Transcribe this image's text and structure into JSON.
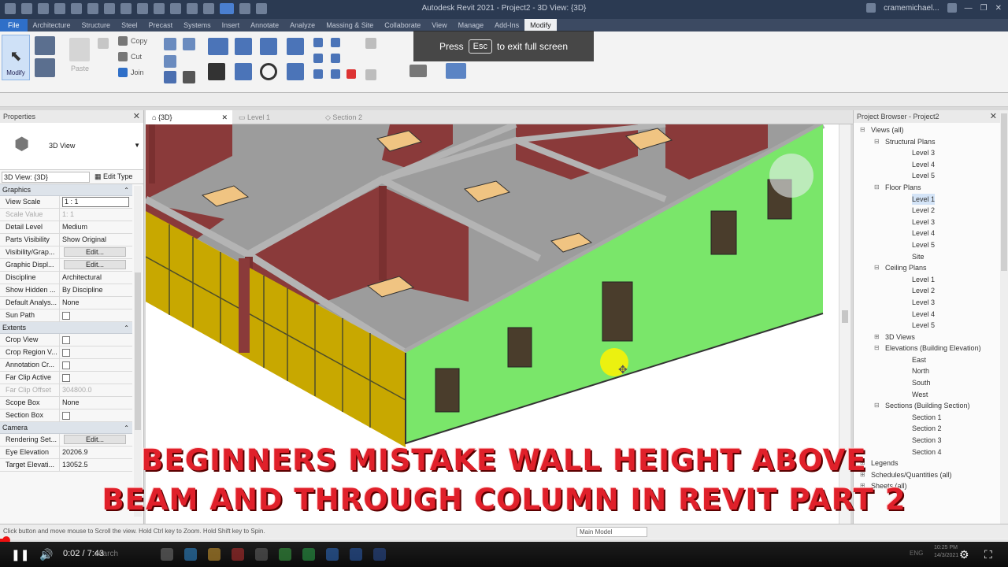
{
  "window": {
    "title": "Autodesk Revit 2021 - Project2 - 3D View: {3D}",
    "user": "cramemichael..."
  },
  "ribbon": {
    "tabs": [
      "File",
      "Architecture",
      "Structure",
      "Steel",
      "Precast",
      "Systems",
      "Insert",
      "Annotate",
      "Analyze",
      "Massing & Site",
      "Collaborate",
      "View",
      "Manage",
      "Add-Ins",
      "Modify"
    ],
    "active_tab": "Modify",
    "modify_label": "Modify",
    "paste_label": "Paste",
    "copy_label": "Copy",
    "cut_label": "Cut",
    "join_label": "Join"
  },
  "toast": {
    "before": "Press",
    "key": "Esc",
    "after": "to exit full screen"
  },
  "properties": {
    "title": "Properties",
    "type_name": "3D View",
    "view_selector": "3D View: {3D}",
    "edit_type": "Edit Type",
    "groups": {
      "graphics": "Graphics",
      "extents": "Extents",
      "camera": "Camera"
    },
    "rows": {
      "view_scale": {
        "k": "View Scale",
        "v": "1 : 1"
      },
      "scale_value": {
        "k": "Scale Value",
        "v": "1: 1"
      },
      "detail_level": {
        "k": "Detail Level",
        "v": "Medium"
      },
      "parts_visibility": {
        "k": "Parts Visibility",
        "v": "Show Original"
      },
      "visibility_graphics": {
        "k": "Visibility/Grap...",
        "v": "Edit..."
      },
      "graphic_display": {
        "k": "Graphic Displ...",
        "v": "Edit..."
      },
      "discipline": {
        "k": "Discipline",
        "v": "Architectural"
      },
      "show_hidden": {
        "k": "Show Hidden ...",
        "v": "By Discipline"
      },
      "default_analysis": {
        "k": "Default Analys...",
        "v": "None"
      },
      "sun_path": {
        "k": "Sun Path",
        "v": ""
      },
      "crop_view": {
        "k": "Crop View",
        "v": ""
      },
      "crop_region": {
        "k": "Crop Region V...",
        "v": ""
      },
      "annotation_crop": {
        "k": "Annotation Cr...",
        "v": ""
      },
      "far_clip_active": {
        "k": "Far Clip Active",
        "v": ""
      },
      "far_clip_offset": {
        "k": "Far Clip Offset",
        "v": "304800.0"
      },
      "scope_box": {
        "k": "Scope Box",
        "v": "None"
      },
      "section_box": {
        "k": "Section Box",
        "v": ""
      },
      "rendering_settings": {
        "k": "Rendering Set...",
        "v": "Edit..."
      },
      "eye_elevation": {
        "k": "Eye Elevation",
        "v": "20206.9"
      },
      "target_elevation": {
        "k": "Target Elevati...",
        "v": "13052.5"
      }
    }
  },
  "view_tabs": [
    {
      "label": "{3D}",
      "active": true
    },
    {
      "label": "Level 1",
      "active": false
    },
    {
      "label": "Section 2",
      "active": false
    }
  ],
  "browser": {
    "title": "Project Browser - Project2",
    "items": [
      {
        "label": "Views (all)",
        "lvl": 0,
        "tg": "⊟"
      },
      {
        "label": "Structural Plans",
        "lvl": 1,
        "tg": "⊟"
      },
      {
        "label": "Level 3",
        "lvl": 2,
        "tg": ""
      },
      {
        "label": "Level 4",
        "lvl": 2,
        "tg": ""
      },
      {
        "label": "Level 5",
        "lvl": 2,
        "tg": ""
      },
      {
        "label": "Floor Plans",
        "lvl": 1,
        "tg": "⊟"
      },
      {
        "label": "Level 1",
        "lvl": 2,
        "tg": "",
        "sel": true
      },
      {
        "label": "Level 2",
        "lvl": 2,
        "tg": ""
      },
      {
        "label": "Level 3",
        "lvl": 2,
        "tg": ""
      },
      {
        "label": "Level 4",
        "lvl": 2,
        "tg": ""
      },
      {
        "label": "Level 5",
        "lvl": 2,
        "tg": ""
      },
      {
        "label": "Site",
        "lvl": 2,
        "tg": ""
      },
      {
        "label": "Ceiling Plans",
        "lvl": 1,
        "tg": "⊟"
      },
      {
        "label": "Level 1",
        "lvl": 2,
        "tg": ""
      },
      {
        "label": "Level 2",
        "lvl": 2,
        "tg": ""
      },
      {
        "label": "Level 3",
        "lvl": 2,
        "tg": ""
      },
      {
        "label": "Level 4",
        "lvl": 2,
        "tg": ""
      },
      {
        "label": "Level 5",
        "lvl": 2,
        "tg": ""
      },
      {
        "label": "3D Views",
        "lvl": 1,
        "tg": "⊞"
      },
      {
        "label": "Elevations (Building Elevation)",
        "lvl": 1,
        "tg": "⊟"
      },
      {
        "label": "East",
        "lvl": 2,
        "tg": ""
      },
      {
        "label": "North",
        "lvl": 2,
        "tg": ""
      },
      {
        "label": "South",
        "lvl": 2,
        "tg": ""
      },
      {
        "label": "West",
        "lvl": 2,
        "tg": ""
      },
      {
        "label": "Sections (Building Section)",
        "lvl": 1,
        "tg": "⊟"
      },
      {
        "label": "Section 1",
        "lvl": 2,
        "tg": ""
      },
      {
        "label": "Section 2",
        "lvl": 2,
        "tg": ""
      },
      {
        "label": "Section 3",
        "lvl": 2,
        "tg": ""
      },
      {
        "label": "Section 4",
        "lvl": 2,
        "tg": ""
      },
      {
        "label": "Legends",
        "lvl": 0,
        "tg": "⊞"
      },
      {
        "label": "Schedules/Quantities (all)",
        "lvl": 0,
        "tg": "⊞"
      },
      {
        "label": "Sheets (all)",
        "lvl": 0,
        "tg": "⊞"
      }
    ]
  },
  "status": {
    "hint": "Click button and move mouse to Scroll the view. Hold Ctrl key to Zoom. Hold Shift key to Spin.",
    "main_model": "Main Model"
  },
  "headline": {
    "line1": "BEGINNERS MISTAKE WALL HEIGHT ABOVE",
    "line2": "BEAM AND THROUGH COLUMN IN REVIT PART 2"
  },
  "video": {
    "time": "0:02 / 7:43",
    "progress_fraction": 0.004,
    "search_placeholder": "search",
    "clock": "10:25 PM",
    "date": "14/3/2021",
    "lang": "ENG"
  },
  "colors": {
    "exterior_wall": "#7ae66a",
    "interior_wall": "#8a3a3a",
    "floor": "#9c9c9c",
    "curtain_glass": "#c8a800",
    "headline": "#e0202a"
  }
}
